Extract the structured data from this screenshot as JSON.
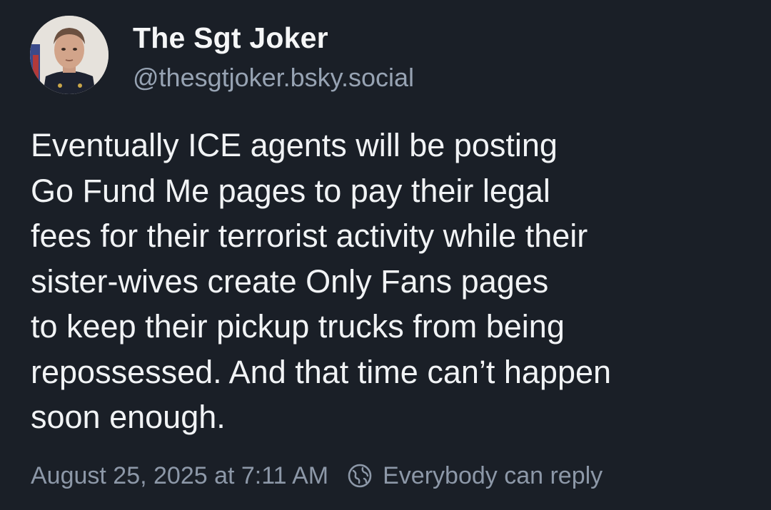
{
  "author": {
    "display_name": "The Sgt Joker",
    "handle": "@thesgtjoker.bsky.social"
  },
  "post": {
    "lines": [
      "Eventually ICE agents will be posting",
      "Go Fund Me pages to pay their legal",
      "fees for their terrorist activity while their",
      "sister-wives create Only Fans pages",
      "to keep their pickup trucks from being",
      "repossessed. And that time can’t happen",
      "soon enough."
    ],
    "timestamp": "August 25, 2025 at 7:11 AM",
    "reply_setting": "Everybody can reply"
  },
  "icons": {
    "reply_setting_icon": "globe-icon"
  },
  "colors": {
    "background": "#1a1f27",
    "text_primary": "#f1f3f5",
    "text_secondary": "#8d98a8"
  }
}
